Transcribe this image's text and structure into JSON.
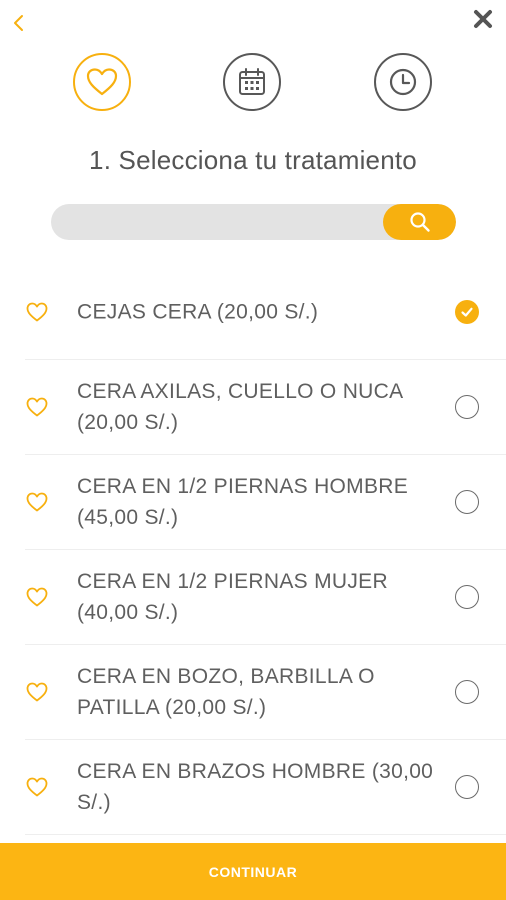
{
  "nav": {
    "back_icon": "chevron-left-icon",
    "close_icon": "close-icon"
  },
  "steps": [
    {
      "icon": "heart-icon",
      "state": "active"
    },
    {
      "icon": "calendar-icon",
      "state": "inactive"
    },
    {
      "icon": "clock-icon",
      "state": "inactive"
    }
  ],
  "title": "1. Selecciona tu tratamiento",
  "search": {
    "placeholder": "",
    "value": "",
    "icon": "search-icon"
  },
  "treatments": [
    {
      "label": "CEJAS CERA (20,00 S/.)",
      "selected": true
    },
    {
      "label": "CERA AXILAS, CUELLO O NUCA (20,00 S/.)",
      "selected": false
    },
    {
      "label": "CERA EN 1/2 PIERNAS HOMBRE (45,00 S/.)",
      "selected": false
    },
    {
      "label": "CERA EN 1/2 PIERNAS MUJER (40,00 S/.)",
      "selected": false
    },
    {
      "label": "CERA EN BOZO, BARBILLA O PATILLA (20,00 S/.)",
      "selected": false
    },
    {
      "label": "CERA EN BRAZOS HOMBRE (30,00 S/.)",
      "selected": false
    }
  ],
  "footer": {
    "continue_label": "CONTINUAR"
  },
  "colors": {
    "accent": "#F7B00F",
    "footer": "#FCB513",
    "text": "#5f5f5f"
  }
}
